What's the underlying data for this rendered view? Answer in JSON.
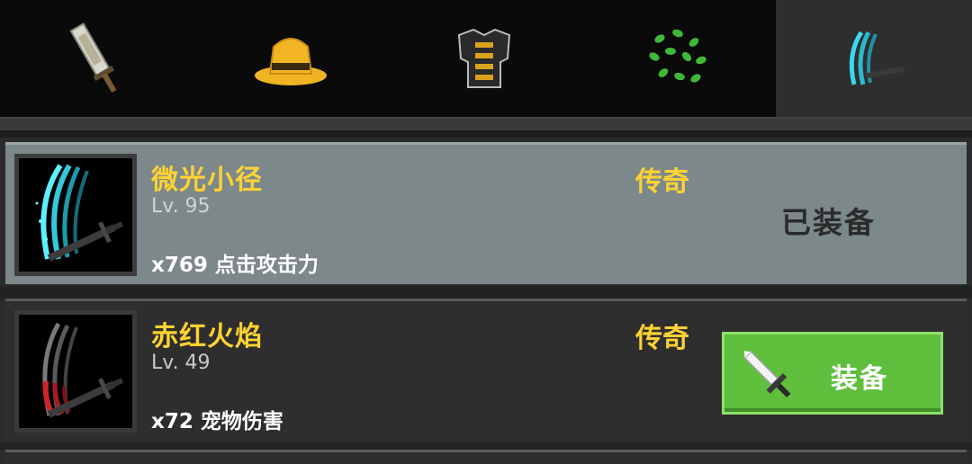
{
  "tabs": [
    {
      "icon": "sword-icon",
      "active": false
    },
    {
      "icon": "hat-icon",
      "active": false
    },
    {
      "icon": "armor-icon",
      "active": false
    },
    {
      "icon": "leaves-icon",
      "active": false
    },
    {
      "icon": "weapon-skin-icon",
      "active": true
    }
  ],
  "items": [
    {
      "name": "微光小径",
      "level": "Lv. 95",
      "bonus": "x769 点击攻击力",
      "rarity": "传奇",
      "status": "已装备",
      "trail_color": "#38d7e8"
    },
    {
      "name": "赤红火焰",
      "level": "Lv. 49",
      "bonus": "x72 宠物伤害",
      "rarity": "传奇",
      "equip_label": "装备",
      "trail_color": "#d0262a"
    }
  ],
  "colors": {
    "accent_yellow": "#ffd233",
    "equip_green": "#5fbf3d"
  }
}
